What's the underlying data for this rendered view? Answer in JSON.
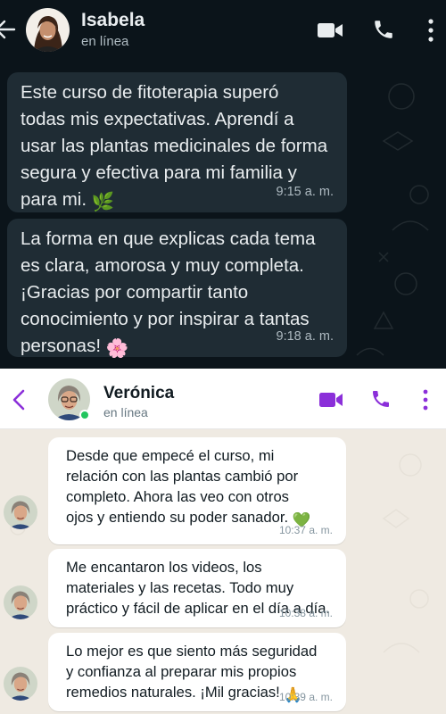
{
  "top_chat": {
    "contact_name": "Isabela",
    "status": "en línea",
    "messages": [
      {
        "text": "Este curso de fitoterapia superó\ntodas mis expectativas. Aprendí a\nusar las plantas medicinales de forma\nsegura y efectiva para mi familia y\npara mi.",
        "emoji": "🌿",
        "time": "9:15 a. m."
      },
      {
        "text": "La forma en que explicas cada tema\nes clara, amorosa y muy completa.\n¡Gracias por compartir tanto\nconocimiento y por inspirar a tantas\npersonas!",
        "emoji": "🌸",
        "time": "9:18 a. m."
      }
    ],
    "icons": [
      "back-arrow-icon",
      "video-call-icon",
      "phone-icon",
      "more-vertical-icon"
    ],
    "colors": {
      "header": "#0b141a",
      "bubble": "#1f2c34",
      "text": "#e9edef",
      "muted": "#aebac1"
    }
  },
  "bottom_chat": {
    "contact_name": "Verónica",
    "status": "en línea",
    "messages": [
      {
        "text": "Desde que empecé el curso, mi\nrelación con las plantas cambió por\ncompleto. Ahora las veo con otros\nojos y entiendo su poder sanador.",
        "emoji": "💚",
        "time": "10:37 a. m."
      },
      {
        "text": "Me encantaron los videos, los\nmateriales y las recetas. Todo muy\npráctico y fácil de aplicar en el día a día.",
        "emoji": "",
        "time": "10:38 a. m."
      },
      {
        "text": "Lo mejor es que siento más seguridad\ny confianza al preparar mis propios\nremedios naturales.  ¡Mil gracias!",
        "emoji": "🙏",
        "time": "10:39 a. m."
      }
    ],
    "icons": [
      "chevron-left-icon",
      "video-call-icon",
      "phone-icon",
      "more-vertical-icon"
    ],
    "colors": {
      "accent": "#8b2fd9",
      "online_dot": "#22c55e",
      "bubble": "#ffffff",
      "background": "#efeae2"
    }
  }
}
